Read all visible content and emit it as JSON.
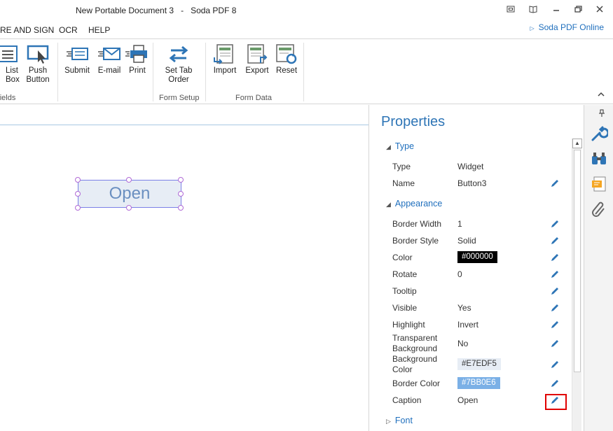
{
  "window": {
    "title": "New Portable Document 3   -   Soda PDF 8"
  },
  "menu": {
    "items": [
      "RE AND SIGN",
      "OCR",
      "HELP"
    ],
    "online_link": "Soda PDF Online"
  },
  "ribbon": {
    "buttons": {
      "list_box": "List\nBox",
      "push_button": "Push\nButton",
      "submit": "Submit",
      "email": "E-mail",
      "print": "Print",
      "set_tab_order": "Set Tab\nOrder",
      "import": "Import",
      "export": "Export",
      "reset": "Reset"
    },
    "groups": {
      "fields": "Fields",
      "form_setup": "Form Setup",
      "form_data": "Form Data"
    }
  },
  "document": {
    "widget_caption": "Open"
  },
  "properties": {
    "title": "Properties",
    "sections": {
      "type": "Type",
      "appearance": "Appearance",
      "font": "Font"
    },
    "type_rows": [
      {
        "label": "Type",
        "value": "Widget"
      },
      {
        "label": "Name",
        "value": "Button3"
      }
    ],
    "appearance_rows": [
      {
        "label": "Border Width",
        "value": "1"
      },
      {
        "label": "Border Style",
        "value": "Solid"
      },
      {
        "label": "Color",
        "value": "#000000"
      },
      {
        "label": "Rotate",
        "value": "0"
      },
      {
        "label": "Tooltip",
        "value": ""
      },
      {
        "label": "Visible",
        "value": "Yes"
      },
      {
        "label": "Highlight",
        "value": "Invert"
      },
      {
        "label": "Transparent Background",
        "value": "No"
      },
      {
        "label": "Background Color",
        "value": "#E7EDF5"
      },
      {
        "label": "Border Color",
        "value": "#7BB0E6"
      },
      {
        "label": "Caption",
        "value": "Open"
      }
    ]
  },
  "colors": {
    "accent": "#2e75b6",
    "widget_fill": "#e7edf5",
    "widget_border": "#7b80e6",
    "color_chip": "#000000",
    "background_chip": "#e7edf5",
    "border_chip": "#7bb0e6",
    "highlight_box": "#e00000"
  },
  "icons": [
    "restore-view-icon",
    "book-icon",
    "minimize-icon",
    "maximize-icon",
    "close-icon",
    "pencil-icon",
    "wrench-icon",
    "binoculars-icon",
    "comment-icon",
    "paperclip-icon",
    "pin-icon"
  ]
}
